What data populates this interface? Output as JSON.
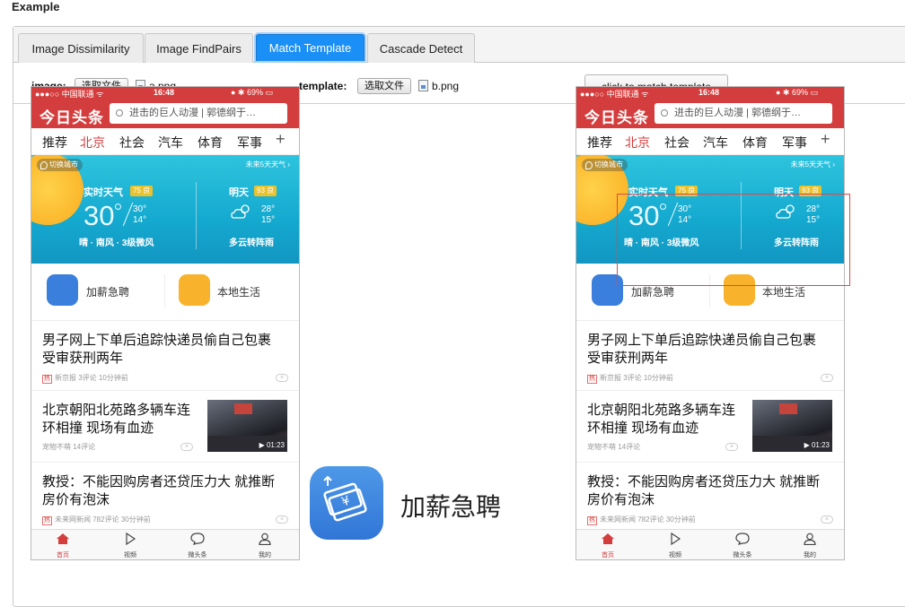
{
  "page_heading": "Example",
  "tabs": [
    {
      "label": "Image Dissimilarity",
      "active": false
    },
    {
      "label": "Image FindPairs",
      "active": false
    },
    {
      "label": "Match Template",
      "active": true
    },
    {
      "label": "Cascade Detect",
      "active": false
    }
  ],
  "controls": {
    "image_label": "image:",
    "image_button": "选取文件",
    "image_file": "a.png",
    "template_label": "template:",
    "template_button": "选取文件",
    "template_file": "b.png",
    "match_button": "click to match template"
  },
  "phone": {
    "status": {
      "carrier": "●●●○○ 中国联通 ᯤ",
      "time": "16:48",
      "battery": "● ✱ 69% ▭"
    },
    "logo": "今日头条",
    "search_placeholder": "进击的巨人动漫 | 郭德纲于…",
    "categories": [
      "推荐",
      "北京",
      "社会",
      "汽车",
      "体育",
      "军事"
    ],
    "selected_category": "北京",
    "plus": "+",
    "weather": {
      "switch_city": "切换城市",
      "forecast_link": "未来5天天气 ›",
      "realtime_label": "实时天气",
      "realtime_aqi": "75 良",
      "temp": "30",
      "high": "30°",
      "low": "14°",
      "wind": "晴 · 南风 · 3级微风",
      "tomorrow_label": "明天",
      "tomorrow_aqi": "93 良",
      "tomorrow_high": "28°",
      "tomorrow_low": "15°",
      "tomorrow_desc": "多云转阵雨"
    },
    "services": [
      {
        "label": "加薪急聘",
        "color": "#3a7fdc"
      },
      {
        "label": "本地生活",
        "color": "#f8b22b"
      }
    ],
    "news": [
      {
        "title_line1": "男子网上下单后追踪快递员偷自己包裹",
        "title_line2": "受审获刑两年",
        "hot": "热",
        "source": "新京报",
        "comments": "3评论",
        "time": "10分钟前"
      },
      {
        "title_line1": "北京朝阳北苑路多辆车连",
        "title_line2": "环相撞 现场有血迹",
        "source": "宠物不萌",
        "comments": "14评论",
        "duration": "▶ 01:23"
      },
      {
        "title_line1": "教授：不能因购房者还贷压力大 就推断",
        "title_line2": "房价有泡沫",
        "hot": "热",
        "source": "未来网新闻",
        "comments": "782评论",
        "time": "30分钟前"
      }
    ],
    "dismiss": "×",
    "bottom_tabs": [
      {
        "label": "首页",
        "icon": "home-icon",
        "active": true
      },
      {
        "label": "视频",
        "icon": "play-icon",
        "active": false
      },
      {
        "label": "微头条",
        "icon": "chat-bubble-icon",
        "active": false
      },
      {
        "label": "我的",
        "icon": "person-icon",
        "active": false
      }
    ]
  },
  "template": {
    "label": "加薪急聘"
  },
  "colors": {
    "accent": "#1a8ff5",
    "brand_red": "#d43d3d",
    "match_rect": "#e04848"
  }
}
